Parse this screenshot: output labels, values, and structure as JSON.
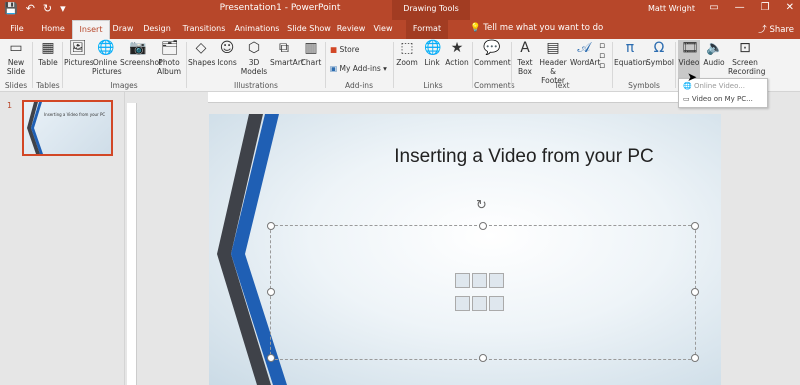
{
  "titlebar": {
    "title": "Presentation1 - PowerPoint",
    "context_tab_group": "Drawing Tools",
    "user": "Matt Wright"
  },
  "tabs": [
    "File",
    "Home",
    "Insert",
    "Draw",
    "Design",
    "Transitions",
    "Animations",
    "Slide Show",
    "Review",
    "View",
    "Format"
  ],
  "active_tab": "Insert",
  "tell_me": "Tell me what you want to do",
  "share": "Share",
  "ribbon": {
    "new_slide": "New Slide",
    "table": "Table",
    "pictures": "Pictures",
    "online_pictures": "Online Pictures",
    "screenshot": "Screenshot",
    "photo_album": "Photo Album",
    "shapes": "Shapes",
    "icons": "Icons",
    "models_3d": "3D Models",
    "smartart": "SmartArt",
    "chart": "Chart",
    "store": "Store",
    "my_addins": "My Add-ins",
    "zoom": "Zoom",
    "link": "Link",
    "action": "Action",
    "comment": "Comment",
    "text_box": "Text Box",
    "header_footer": "Header & Footer",
    "wordart": "WordArt",
    "equation": "Equation",
    "symbol": "Symbol",
    "video": "Video",
    "audio": "Audio",
    "screen_recording": "Screen Recording",
    "groups": {
      "slides": "Slides",
      "tables": "Tables",
      "images": "Images",
      "illustrations": "Illustrations",
      "addins": "Add-ins",
      "links": "Links",
      "comments": "Comments",
      "text": "Text",
      "symbols": "Symbols"
    }
  },
  "video_menu": {
    "online_video": "Online Video...",
    "video_on_pc": "Video on My PC..."
  },
  "slide_panel": {
    "slide_number": "1",
    "thumb_title": "Inserting a Video from your PC"
  },
  "slide": {
    "title": "Inserting a Video from your PC"
  },
  "colors": {
    "accent": "#b7472a",
    "ribbon_bg": "#f3f3f3",
    "stripe_dark": "#3f4249",
    "stripe_blue": "#1f5fb4"
  }
}
